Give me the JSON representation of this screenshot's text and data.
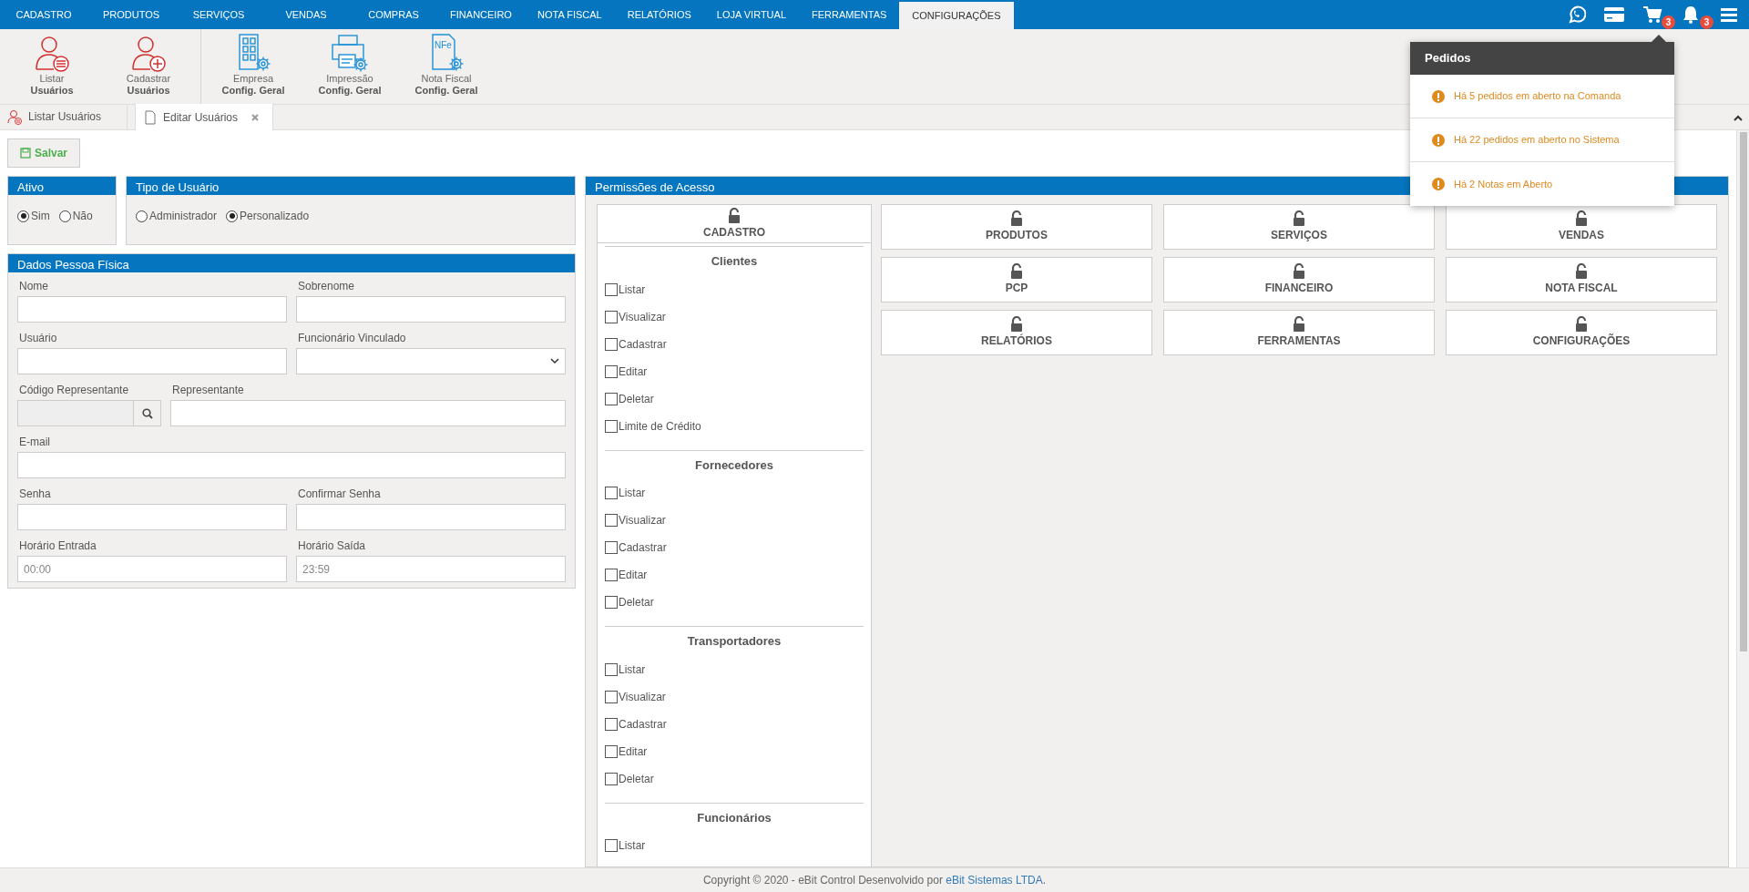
{
  "top_menu": [
    {
      "label": "CADASTRO",
      "selected": false
    },
    {
      "label": "PRODUTOS",
      "selected": false
    },
    {
      "label": "SERVIÇOS",
      "selected": false
    },
    {
      "label": "VENDAS",
      "selected": false
    },
    {
      "label": "COMPRAS",
      "selected": false
    },
    {
      "label": "FINANCEIRO",
      "selected": false
    },
    {
      "label": "NOTA FISCAL",
      "selected": false
    },
    {
      "label": "RELATÓRIOS",
      "selected": false
    },
    {
      "label": "LOJA VIRTUAL",
      "selected": false
    },
    {
      "label": "FERRAMENTAS",
      "selected": false
    },
    {
      "label": "CONFIGURAÇÕES",
      "selected": true
    }
  ],
  "header_icons": [
    {
      "kind": "whatsapp"
    },
    {
      "kind": "card"
    },
    {
      "kind": "cart",
      "badge": "3"
    },
    {
      "kind": "bell",
      "badge": "3"
    },
    {
      "kind": "menu"
    }
  ],
  "toolbar_groups": [
    [
      {
        "kind": "user-list",
        "line1": "Listar",
        "line2": "Usuários"
      },
      {
        "kind": "user-add",
        "line1": "Cadastrar",
        "line2": "Usuários"
      }
    ],
    [
      {
        "kind": "building",
        "line1": "Empresa",
        "line2": "Config. Geral"
      },
      {
        "kind": "printer",
        "line1": "Impressão",
        "line2": "Config. Geral"
      },
      {
        "kind": "document",
        "icon_text": "NFe",
        "line1": "Nota Fiscal",
        "line2": "Config. Geral"
      }
    ]
  ],
  "tabs": [
    {
      "kind": "user-list",
      "label": "Listar Usuários",
      "selected": false,
      "closable": false
    },
    {
      "kind": "document",
      "label": "Editar Usuários",
      "selected": true,
      "closable": true
    }
  ],
  "save_button": "Salvar",
  "ativo": {
    "title": "Ativo",
    "options": [
      {
        "label": "Sim",
        "selected": true
      },
      {
        "label": "Não",
        "selected": false
      }
    ]
  },
  "tipo_usuario": {
    "title": "Tipo de Usuário",
    "options": [
      {
        "label": "Administrador",
        "selected": false
      },
      {
        "label": "Personalizado",
        "selected": true
      }
    ]
  },
  "dados_pessoa_fisica": {
    "title": "Dados Pessoa Física",
    "rows": [
      [
        {
          "label": "Nome",
          "kind": "text"
        },
        {
          "label": "Sobrenome",
          "kind": "text"
        }
      ],
      [
        {
          "label": "Usuário",
          "kind": "text"
        },
        {
          "label": "Funcionário Vinculado",
          "kind": "select"
        }
      ],
      [
        {
          "label": "Código Representante",
          "kind": "lookup"
        },
        {
          "label": "Representante",
          "kind": "text"
        }
      ],
      [
        {
          "label": "E-mail",
          "kind": "text"
        }
      ],
      [
        {
          "label": "Senha",
          "kind": "text"
        },
        {
          "label": "Confirmar Senha",
          "kind": "text"
        }
      ],
      [
        {
          "label": "Horário Entrada",
          "kind": "text",
          "value": "00:00"
        },
        {
          "label": "Horário Saída",
          "kind": "text",
          "value": "23:59"
        }
      ]
    ]
  },
  "permissoes": {
    "title": "Permissões de Acesso",
    "cadastro": {
      "label": "CADASTRO",
      "groups": [
        {
          "title": "Clientes",
          "items": [
            {
              "label": "Listar",
              "checked": false
            },
            {
              "label": "Visualizar",
              "checked": false
            },
            {
              "label": "Cadastrar",
              "checked": false
            },
            {
              "label": "Editar",
              "checked": false
            },
            {
              "label": "Deletar",
              "checked": false
            },
            {
              "label": "Limite de Crédito",
              "checked": false
            }
          ]
        },
        {
          "title": "Fornecedores",
          "items": [
            {
              "label": "Listar",
              "checked": false
            },
            {
              "label": "Visualizar",
              "checked": false
            },
            {
              "label": "Cadastrar",
              "checked": false
            },
            {
              "label": "Editar",
              "checked": false
            },
            {
              "label": "Deletar",
              "checked": false
            }
          ]
        },
        {
          "title": "Transportadores",
          "items": [
            {
              "label": "Listar",
              "checked": false
            },
            {
              "label": "Visualizar",
              "checked": false
            },
            {
              "label": "Cadastrar",
              "checked": false
            },
            {
              "label": "Editar",
              "checked": false
            },
            {
              "label": "Deletar",
              "checked": false
            }
          ]
        },
        {
          "title": "Funcionários",
          "items": [
            {
              "label": "Listar",
              "checked": false
            }
          ]
        }
      ]
    },
    "modules": [
      {
        "label": "PRODUTOS"
      },
      {
        "label": "SERVIÇOS"
      },
      {
        "label": "VENDAS"
      },
      {
        "label": "PCP"
      },
      {
        "label": "FINANCEIRO"
      },
      {
        "label": "NOTA FISCAL"
      },
      {
        "label": "RELATÓRIOS"
      },
      {
        "label": "FERRAMENTAS"
      },
      {
        "label": "CONFIGURAÇÕES"
      }
    ]
  },
  "notifications": {
    "title": "Pedidos",
    "items": [
      {
        "text": "Há 5 pedidos em aberto na Comanda"
      },
      {
        "text": "Há 22 pedidos em aberto no Sistema"
      },
      {
        "text": "Há 2 Notas em Aberto"
      }
    ]
  },
  "footer": {
    "text": "Copyright © 2020 - eBit Control Desenvolvido por ",
    "link": "eBit Sistemas LTDA",
    "suffix": "."
  }
}
